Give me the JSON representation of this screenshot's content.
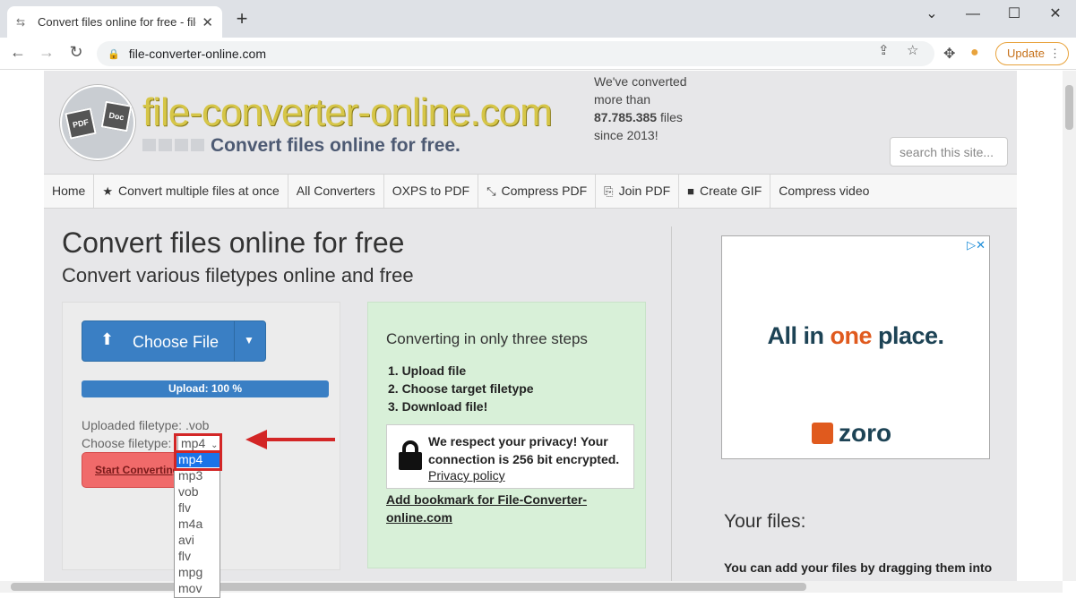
{
  "browser": {
    "tab_title": "Convert files online for free - file",
    "new_tab": "+",
    "url": "file-converter-online.com",
    "update_label": "Update"
  },
  "site": {
    "logo_text": "file-converter-online.com",
    "logo_tagline": "Convert files online for free.",
    "logo_pdf": "PDF",
    "logo_doc": "Doc",
    "stats": {
      "line1": "We've converted",
      "line2": "more than",
      "count": "87.785.385",
      "line3": "files",
      "line4": "since 2013!"
    },
    "search_placeholder": "search this site...",
    "menu": [
      {
        "label": "Home",
        "icon": ""
      },
      {
        "label": "Convert multiple files at once",
        "icon": "star-icon"
      },
      {
        "label": "All Converters",
        "icon": ""
      },
      {
        "label": "OXPS to PDF",
        "icon": ""
      },
      {
        "label": "Compress PDF",
        "icon": "compress-icon"
      },
      {
        "label": "Join PDF",
        "icon": "copy-icon"
      },
      {
        "label": "Create GIF",
        "icon": "video-camera-icon"
      },
      {
        "label": "Compress video",
        "icon": ""
      }
    ]
  },
  "main": {
    "title": "Convert files online for free",
    "subtitle": "Convert various filetypes online and free",
    "upload": {
      "choose_file_label": "Choose File",
      "progress_text": "Upload: 100 %",
      "progress_value": 1.0,
      "uploaded_filetype": "Uploaded filetype: .vob",
      "choose_filetype_label": "Choose filetype:",
      "selected_filetype": "mp4",
      "start_button": "Start Converting"
    },
    "dropdown_options": [
      "mp4",
      "mp3",
      "vob",
      "flv",
      "m4a",
      "avi",
      "flv",
      "mpg",
      "mov"
    ],
    "steps": {
      "heading": "Converting in only three steps",
      "items": [
        "1. Upload file",
        "2. Choose target filetype",
        "3. Download file!"
      ],
      "privacy_text": "We respect your privacy! Your connection is 256 bit encrypted.",
      "privacy_link": "Privacy policy",
      "bookmark_link": "Add bookmark for File-Converter-online.com"
    },
    "ad": {
      "title_pre": "All in ",
      "title_accent": "one",
      "title_post": " place.",
      "brand": "zoro",
      "accent_color": "#e05a1e"
    },
    "your_files_heading": "Your files:",
    "drag_text": "You can add your files by dragging them into"
  }
}
